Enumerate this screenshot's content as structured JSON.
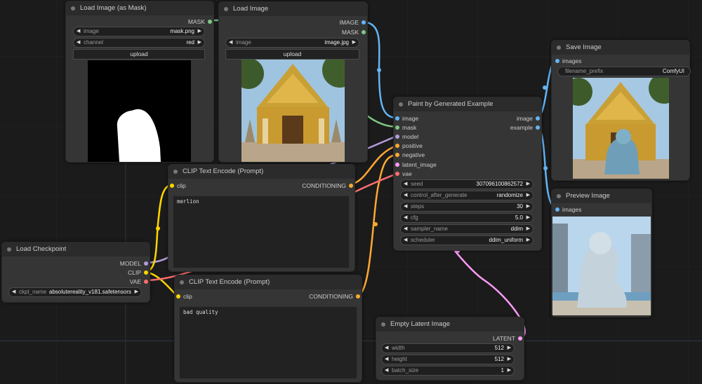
{
  "colors": {
    "image": "#64b5f6",
    "mask": "#81c784",
    "model": "#b39ddb",
    "clip": "#ffd500",
    "conditioning": "#ffa931",
    "latent": "#ff9cf9",
    "vae": "#ff6e6e",
    "neutral": "#aaaaaa"
  },
  "nodes": {
    "load_image_mask": {
      "title": "Load Image (as Mask)",
      "outputs": [
        "MASK"
      ],
      "widgets": [
        {
          "label": "image",
          "value": "mask.png"
        },
        {
          "label": "channel",
          "value": "red"
        }
      ],
      "button": "upload"
    },
    "load_image": {
      "title": "Load Image",
      "outputs": [
        "IMAGE",
        "MASK"
      ],
      "widgets": [
        {
          "label": "image",
          "value": "image.jpg"
        }
      ],
      "button": "upload"
    },
    "paint_by_example": {
      "title": "Paint by Generated Example",
      "inputs": [
        "image",
        "mask",
        "model",
        "positive",
        "negative",
        "latent_image",
        "vae"
      ],
      "outputs": [
        "image",
        "example"
      ],
      "widgets": [
        {
          "label": "seed",
          "value": "307096100862572"
        },
        {
          "label": "control_after_generate",
          "value": "randomize"
        },
        {
          "label": "steps",
          "value": "30"
        },
        {
          "label": "cfg",
          "value": "5.0"
        },
        {
          "label": "sampler_name",
          "value": "ddim"
        },
        {
          "label": "scheduler",
          "value": "ddim_uniform"
        }
      ]
    },
    "save_image": {
      "title": "Save Image",
      "inputs": [
        "images"
      ],
      "widgets": [
        {
          "label": "filename_prefix",
          "value": "ComfyUI"
        }
      ]
    },
    "preview_image": {
      "title": "Preview Image",
      "inputs": [
        "images"
      ]
    },
    "clip_positive": {
      "title": "CLIP Text Encode (Prompt)",
      "inputs": [
        "clip"
      ],
      "outputs": [
        "CONDITIONING"
      ],
      "text": "merlion"
    },
    "clip_negative": {
      "title": "CLIP Text Encode (Prompt)",
      "inputs": [
        "clip"
      ],
      "outputs": [
        "CONDITIONING"
      ],
      "text": "bad quality"
    },
    "load_checkpoint": {
      "title": "Load Checkpoint",
      "outputs": [
        "MODEL",
        "CLIP",
        "VAE"
      ],
      "widgets": [
        {
          "label": "ckpt_name",
          "value": "absolutereality_v181.safetensors"
        }
      ]
    },
    "empty_latent": {
      "title": "Empty Latent Image",
      "outputs": [
        "LATENT"
      ],
      "widgets": [
        {
          "label": "width",
          "value": "512"
        },
        {
          "label": "height",
          "value": "512"
        },
        {
          "label": "batch_size",
          "value": "1"
        }
      ]
    }
  }
}
